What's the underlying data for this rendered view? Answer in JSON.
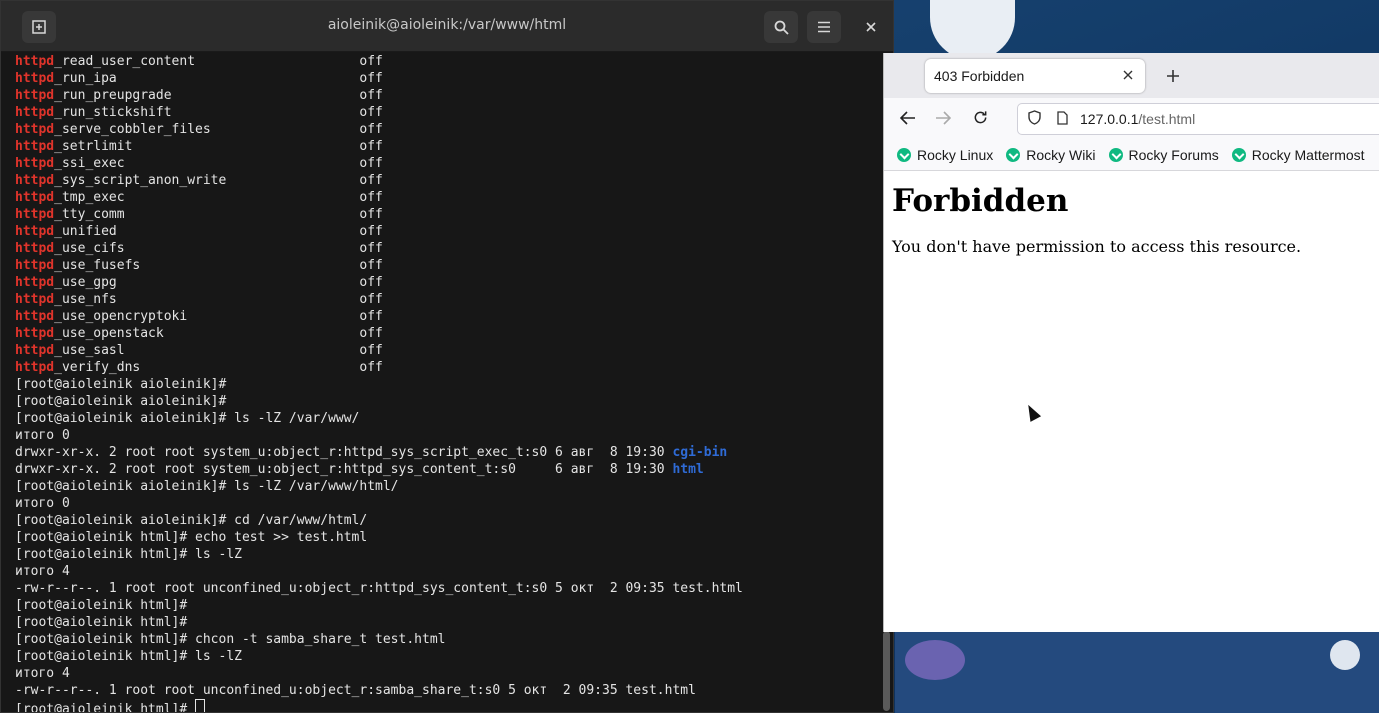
{
  "terminal": {
    "title": "aioleinik@aioleinik:/var/www/html",
    "icons": {
      "new_tab": "new-tab-icon",
      "search": "search-icon",
      "menu": "hamburger-menu-icon",
      "close": "close-icon"
    },
    "bool_rows": [
      {
        "prefix": "httpd",
        "suffix": "_read_user_content",
        "state": "off"
      },
      {
        "prefix": "httpd",
        "suffix": "_run_ipa",
        "state": "off"
      },
      {
        "prefix": "httpd",
        "suffix": "_run_preupgrade",
        "state": "off"
      },
      {
        "prefix": "httpd",
        "suffix": "_run_stickshift",
        "state": "off"
      },
      {
        "prefix": "httpd",
        "suffix": "_serve_cobbler_files",
        "state": "off"
      },
      {
        "prefix": "httpd",
        "suffix": "_setrlimit",
        "state": "off"
      },
      {
        "prefix": "httpd",
        "suffix": "_ssi_exec",
        "state": "off"
      },
      {
        "prefix": "httpd",
        "suffix": "_sys_script_anon_write",
        "state": "off"
      },
      {
        "prefix": "httpd",
        "suffix": "_tmp_exec",
        "state": "off"
      },
      {
        "prefix": "httpd",
        "suffix": "_tty_comm",
        "state": "off"
      },
      {
        "prefix": "httpd",
        "suffix": "_unified",
        "state": "off"
      },
      {
        "prefix": "httpd",
        "suffix": "_use_cifs",
        "state": "off"
      },
      {
        "prefix": "httpd",
        "suffix": "_use_fusefs",
        "state": "off"
      },
      {
        "prefix": "httpd",
        "suffix": "_use_gpg",
        "state": "off"
      },
      {
        "prefix": "httpd",
        "suffix": "_use_nfs",
        "state": "off"
      },
      {
        "prefix": "httpd",
        "suffix": "_use_opencryptoki",
        "state": "off"
      },
      {
        "prefix": "httpd",
        "suffix": "_use_openstack",
        "state": "off"
      },
      {
        "prefix": "httpd",
        "suffix": "_use_sasl",
        "state": "off"
      },
      {
        "prefix": "httpd",
        "suffix": "_verify_dns",
        "state": "off"
      }
    ],
    "lines": [
      {
        "text": "[root@aioleinik aioleinik]#"
      },
      {
        "text": "[root@aioleinik aioleinik]#"
      },
      {
        "text": "[root@aioleinik aioleinik]# ls -lZ /var/www/"
      },
      {
        "text": "итого 0"
      },
      {
        "text": "drwxr-xr-x. 2 root root system_u:object_r:httpd_sys_script_exec_t:s0 6 авг  8 19:30 ",
        "dir": "cgi-bin"
      },
      {
        "text": "drwxr-xr-x. 2 root root system_u:object_r:httpd_sys_content_t:s0     6 авг  8 19:30 ",
        "dir": "html"
      },
      {
        "text": "[root@aioleinik aioleinik]# ls -lZ /var/www/html/"
      },
      {
        "text": "итого 0"
      },
      {
        "text": "[root@aioleinik aioleinik]# cd /var/www/html/"
      },
      {
        "text": "[root@aioleinik html]# echo test >> test.html"
      },
      {
        "text": "[root@aioleinik html]# ls -lZ"
      },
      {
        "text": "итого 4"
      },
      {
        "text": "-rw-r--r--. 1 root root unconfined_u:object_r:httpd_sys_content_t:s0 5 окт  2 09:35 test.html"
      },
      {
        "text": "[root@aioleinik html]#"
      },
      {
        "text": "[root@aioleinik html]#"
      },
      {
        "text": "[root@aioleinik html]# chcon -t samba_share_t test.html"
      },
      {
        "text": "[root@aioleinik html]# ls -lZ"
      },
      {
        "text": "итого 4"
      },
      {
        "text": "-rw-r--r--. 1 root root unconfined_u:object_r:samba_share_t:s0 5 окт  2 09:35 test.html"
      },
      {
        "text": "[root@aioleinik html]# ",
        "cursor": true
      }
    ]
  },
  "browser": {
    "tab_title": "403 Forbidden",
    "url_host": "127.0.0.1",
    "url_path": "/test.html",
    "bookmarks": [
      "Rocky Linux",
      "Rocky Wiki",
      "Rocky Forums",
      "Rocky Mattermost"
    ],
    "page": {
      "heading": "Forbidden",
      "message": "You don't have permission to access this resource."
    },
    "icons": {
      "back": "back-arrow-icon",
      "forward": "forward-arrow-icon",
      "reload": "reload-icon",
      "shield": "tracking-shield-icon",
      "page": "page-icon",
      "close_tab": "close-icon",
      "new_tab": "plus-icon",
      "bookmark": "rocky-logo-icon"
    }
  },
  "colors": {
    "httpd_keyword": "#e0342b",
    "directory": "#2f6bd6",
    "terminal_bg": "#171717",
    "bookmark_icon": "#10b981"
  }
}
